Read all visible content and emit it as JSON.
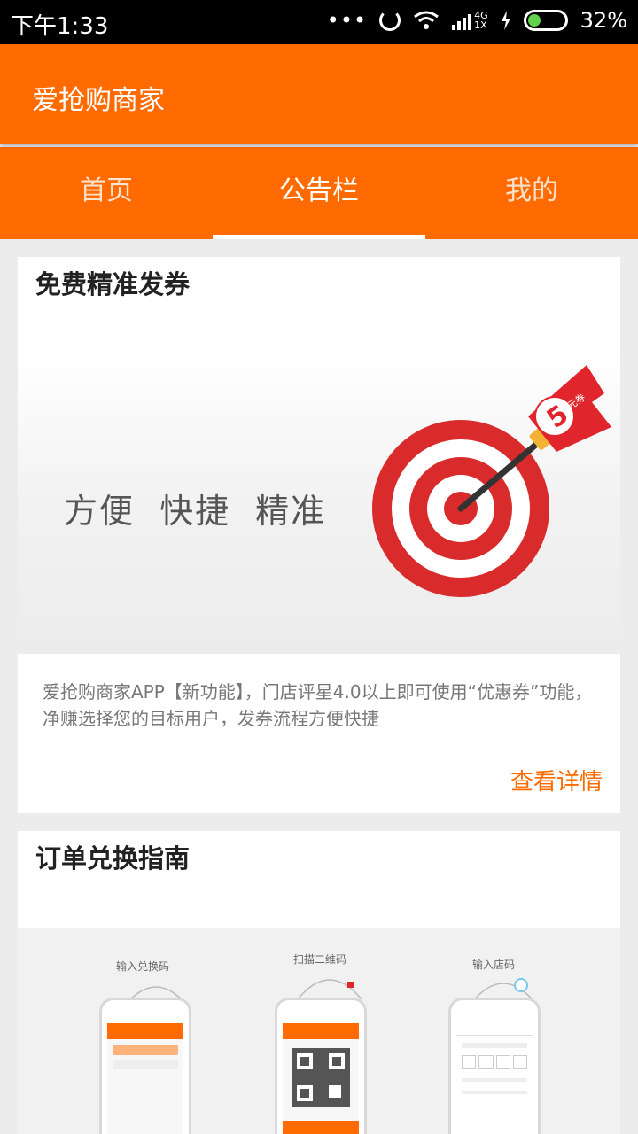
{
  "status_bar": {
    "time": "下午1:33",
    "dots": "•••",
    "network_top": "4G",
    "network_bottom": "1X",
    "battery": "32%",
    "icons": [
      "sync-icon",
      "wifi-icon",
      "signal-icon",
      "charging-icon",
      "battery-icon"
    ]
  },
  "app_bar": {
    "title": "爱抢购商家"
  },
  "tabs": [
    {
      "label": "首页",
      "active": false
    },
    {
      "label": "公告栏",
      "active": true
    },
    {
      "label": "我的",
      "active": false
    }
  ],
  "cards": [
    {
      "title": "免费精准发券",
      "banner_slogan": "方便 快捷 精准",
      "coupon_flag_number": "5",
      "coupon_flag_text": "元券",
      "description": "爱抢购商家APP【新功能】，门店评星4.0以上即可使用“优惠券”功能，净赚选择您的目标用户，发券流程方便快捷",
      "link_label": "查看详情"
    },
    {
      "title": "订单兑换指南",
      "steps": [
        "输入兑换码",
        "扫描二维码",
        "输入店码"
      ]
    }
  ],
  "colors": {
    "brand_orange": "#ff6b00",
    "target_red": "#d92b2b",
    "link_orange": "#ff6b00"
  }
}
